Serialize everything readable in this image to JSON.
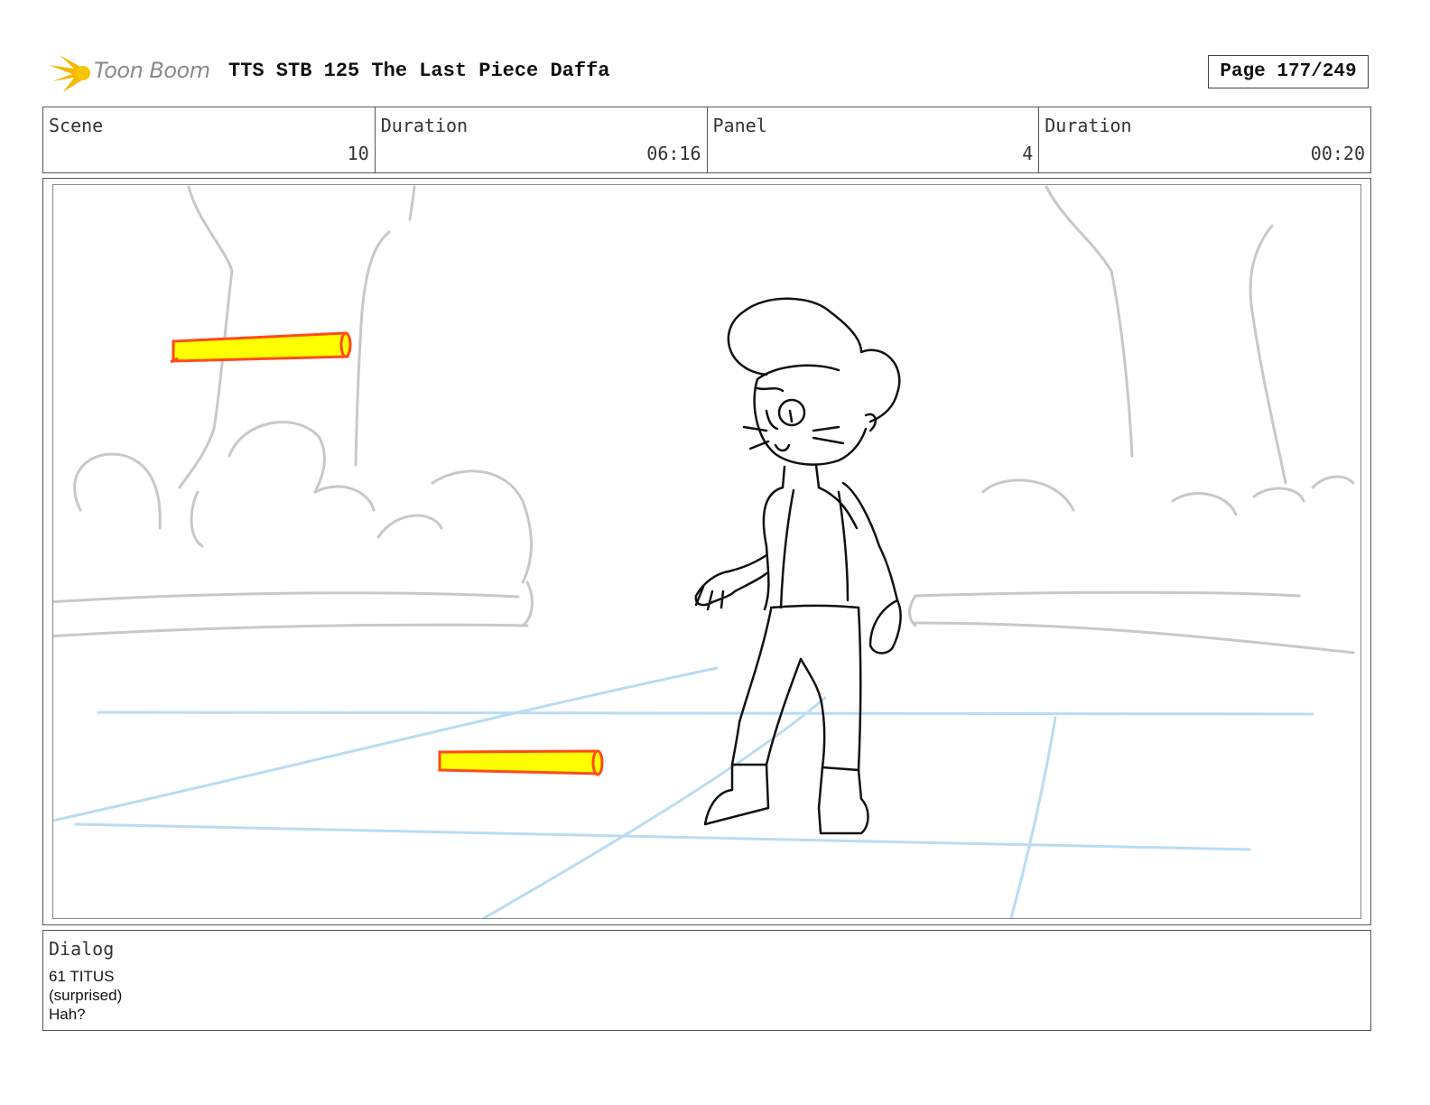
{
  "header": {
    "logo_text": "Toon Boom",
    "title": "TTS STB 125 The Last Piece Daffa",
    "page": "Page 177/249"
  },
  "info": {
    "scene_label": "Scene",
    "scene_value": "10",
    "scene_duration_label": "Duration",
    "scene_duration_value": "06:16",
    "panel_label": "Panel",
    "panel_value": "4",
    "panel_duration_label": "Duration",
    "panel_duration_value": "00:20"
  },
  "dialog": {
    "label": "Dialog",
    "lines": [
      "61 TITUS",
      "(surprised)",
      "Hah?"
    ]
  },
  "colors": {
    "sketch_background": "#c8c8c8",
    "sketch_character": "#111111",
    "sketch_perspective": "#b9dcf2",
    "prop_fill": "#ffff00",
    "prop_outline": "#ff4a1a",
    "logo_star": "#f5b800"
  }
}
